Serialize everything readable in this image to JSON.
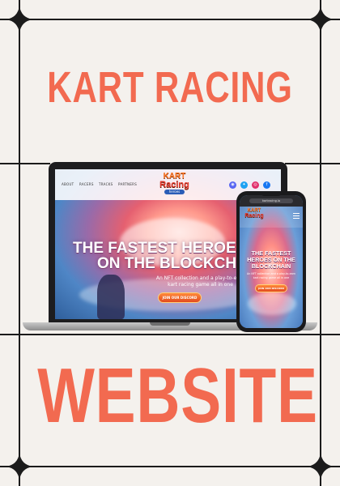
{
  "poster": {
    "headline_top": "KART RACING",
    "headline_bottom": "WEBSITE",
    "accent_color": "#f26a50",
    "background_color": "#f4f1ed"
  },
  "desktop_site": {
    "nav_links": [
      "ABOUT",
      "RACERS",
      "TRACKS",
      "PARTNERS"
    ],
    "logo": {
      "line1": "KART",
      "line2": "Racing",
      "badge": "heroes"
    },
    "social_icons": [
      {
        "name": "discord-icon",
        "glyph": "◉",
        "color": "#5865f2"
      },
      {
        "name": "twitter-icon",
        "glyph": "✦",
        "color": "#1da1f2"
      },
      {
        "name": "instagram-icon",
        "glyph": "◎",
        "color": "#e1306c"
      },
      {
        "name": "facebook-icon",
        "glyph": "f",
        "color": "#1877f2"
      }
    ],
    "hero_title_line1": "THE FASTEST HEROES",
    "hero_title_line2": "ON THE BLOCKCHAIN",
    "hero_subtitle_line1": "An NFT collection and a play-to-earn",
    "hero_subtitle_line2": "kart racing game all in one",
    "cta_label": "JOIN OUR DISCORD"
  },
  "mobile_site": {
    "url": "kartracing.io",
    "logo": {
      "line1": "KART",
      "line2": "Racing"
    },
    "hero_title_line1": "THE FASTEST",
    "hero_title_line2": "HEROES ON THE",
    "hero_title_line3": "BLOCKCHAIN",
    "hero_subtitle_line1": "An NFT collection and a play-to-earn",
    "hero_subtitle_line2": "kart racing game all in one",
    "cta_label": "JOIN OUR DISCORD"
  }
}
